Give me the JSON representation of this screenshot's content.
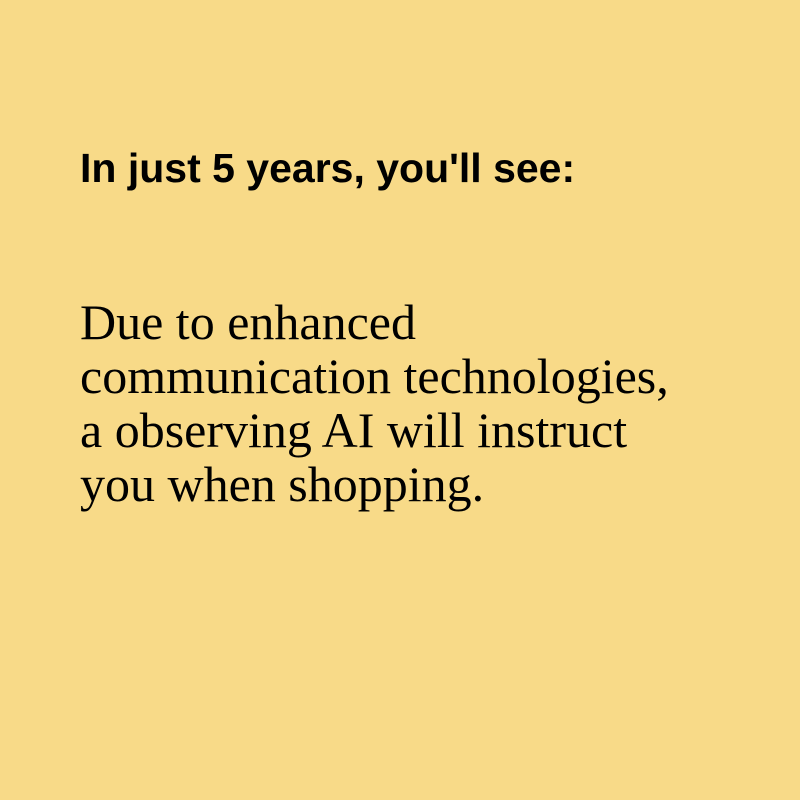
{
  "card": {
    "heading": "In just 5 years, you'll see:",
    "body": "Due to enhanced communication technologies, a observing AI will instruct you when shopping."
  },
  "colors": {
    "background": "#f8da88",
    "text": "#000000"
  }
}
